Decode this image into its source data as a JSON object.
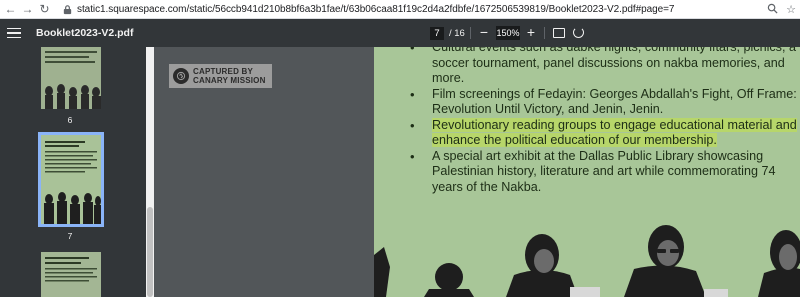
{
  "browser": {
    "url": "static1.squarespace.com/static/56ccb941d210b8bf6a3b1fae/t/63b06caa81f19c2d4a2fdbfe/1672506539819/Booklet2023-V2.pdf#page=7"
  },
  "viewer": {
    "title": "Booklet2023-V2.pdf",
    "current_page": "7",
    "total_pages": "/ 16",
    "zoom": "150%"
  },
  "sidebar": {
    "thumbnails": [
      {
        "label": "6"
      },
      {
        "label": "7",
        "selected": true
      },
      {
        "label": ""
      }
    ]
  },
  "watermark": {
    "line1": "CAPTURED BY",
    "line2": "CANARY MISSION"
  },
  "content": {
    "bullets": [
      "Cultural events such as dabke nights, community iftars, picnics, a soccer tournament, panel discussions on nakba memories, and more.",
      "Film screenings of Fedayin: Georges Abdallah's Fight, Off Frame: Revolution Until Victory, and Jenin, Jenin.",
      "Revolutionary reading groups to engage educational material and enhance the political education of our membership.",
      "A special art exhibit at the Dallas Public Library showcasing Palestinian history, literature and art while commemorating 74 years of the Nakba."
    ],
    "highlighted_index": 2
  },
  "colors": {
    "page_bg": "#a8c698",
    "highlight": "#b7d66a",
    "toolbar": "#323639"
  }
}
